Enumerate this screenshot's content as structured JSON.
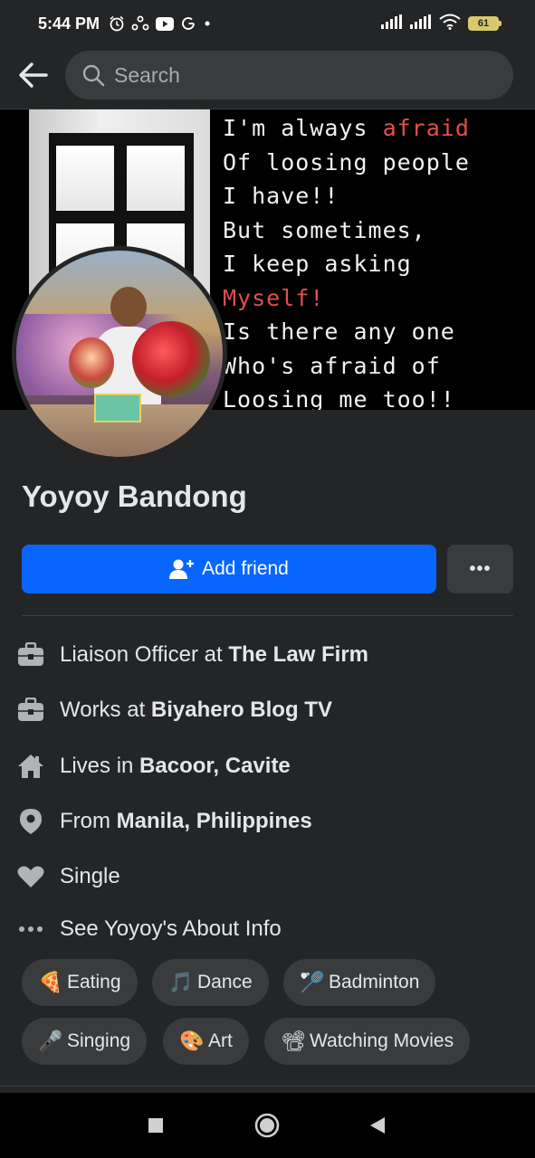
{
  "status_bar": {
    "time": "5:44 PM",
    "left_icons": [
      "alarm-icon",
      "messenger-icon",
      "youtube-icon",
      "google-icon",
      "dot-icon"
    ],
    "battery": "61"
  },
  "header": {
    "search_placeholder": "Search"
  },
  "cover": {
    "lines": [
      {
        "text": "I'm always ",
        "accent": "afraid"
      },
      {
        "text": "Of loosing people",
        "accent": ""
      },
      {
        "text": "I have!!",
        "accent": ""
      },
      {
        "text": "But sometimes,",
        "accent": ""
      },
      {
        "text": "I keep asking",
        "accent": ""
      },
      {
        "text": "",
        "accent": "Myself!"
      },
      {
        "text": "Is there any one",
        "accent": ""
      },
      {
        "text": "Who's afraid of",
        "accent": ""
      },
      {
        "text": "Loosing me too!!",
        "accent": ""
      }
    ],
    "accent_color": "#e0504c"
  },
  "profile": {
    "name": "Yoyoy Bandong",
    "add_friend_label": "Add friend",
    "more_label": "•••"
  },
  "info": [
    {
      "icon": "briefcase-icon",
      "prefix": "Liaison Officer at ",
      "bold": "The Law Firm"
    },
    {
      "icon": "briefcase-icon",
      "prefix": "Works at ",
      "bold": "Biyahero Blog TV"
    },
    {
      "icon": "home-icon",
      "prefix": "Lives in ",
      "bold": "Bacoor, Cavite"
    },
    {
      "icon": "location-pin-icon",
      "prefix": "From ",
      "bold": "Manila, Philippines"
    },
    {
      "icon": "heart-icon",
      "prefix": "Single",
      "bold": ""
    },
    {
      "icon": "more-dots-icon",
      "prefix": "See Yoyoy's About Info",
      "bold": ""
    }
  ],
  "interests": [
    {
      "emoji": "🍕",
      "label": "Eating"
    },
    {
      "emoji": "🎵",
      "label": "Dance"
    },
    {
      "emoji": "🏸",
      "label": "Badminton"
    },
    {
      "emoji": "🎤",
      "label": "Singing"
    },
    {
      "emoji": "🎨",
      "label": "Art"
    },
    {
      "emoji": "📽",
      "label": "Watching Movies"
    }
  ],
  "colors": {
    "background": "#242526",
    "primary_button": "#0866ff",
    "chip": "#3a3b3c"
  }
}
